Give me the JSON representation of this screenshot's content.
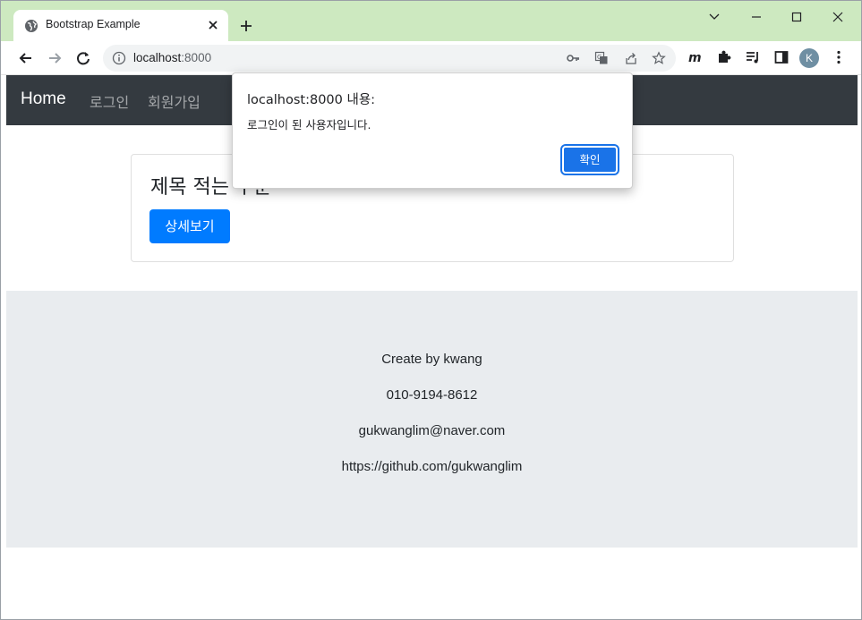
{
  "browser": {
    "tab_title": "Bootstrap Example",
    "url_host": "localhost",
    "url_port": ":8000",
    "profile_initial": "K"
  },
  "navbar": {
    "brand": "Home",
    "links": [
      "로그인",
      "회원가입"
    ]
  },
  "card": {
    "title": "제목 적는 부분",
    "button_label": "상세보기"
  },
  "footer": {
    "lines": [
      "Create by kwang",
      "010-9194-8612",
      "gukwanglim@naver.com",
      "https://github.com/gukwanglim"
    ]
  },
  "dialog": {
    "heading": "localhost:8000 내용:",
    "message": "로그인이 된 사용자입니다.",
    "ok_label": "확인"
  },
  "colors": {
    "tabstrip": "#cde9c0",
    "navbar": "#343a40",
    "primary": "#007bff",
    "footer_bg": "#e9ecef",
    "dialog_button": "#1a73e8"
  }
}
